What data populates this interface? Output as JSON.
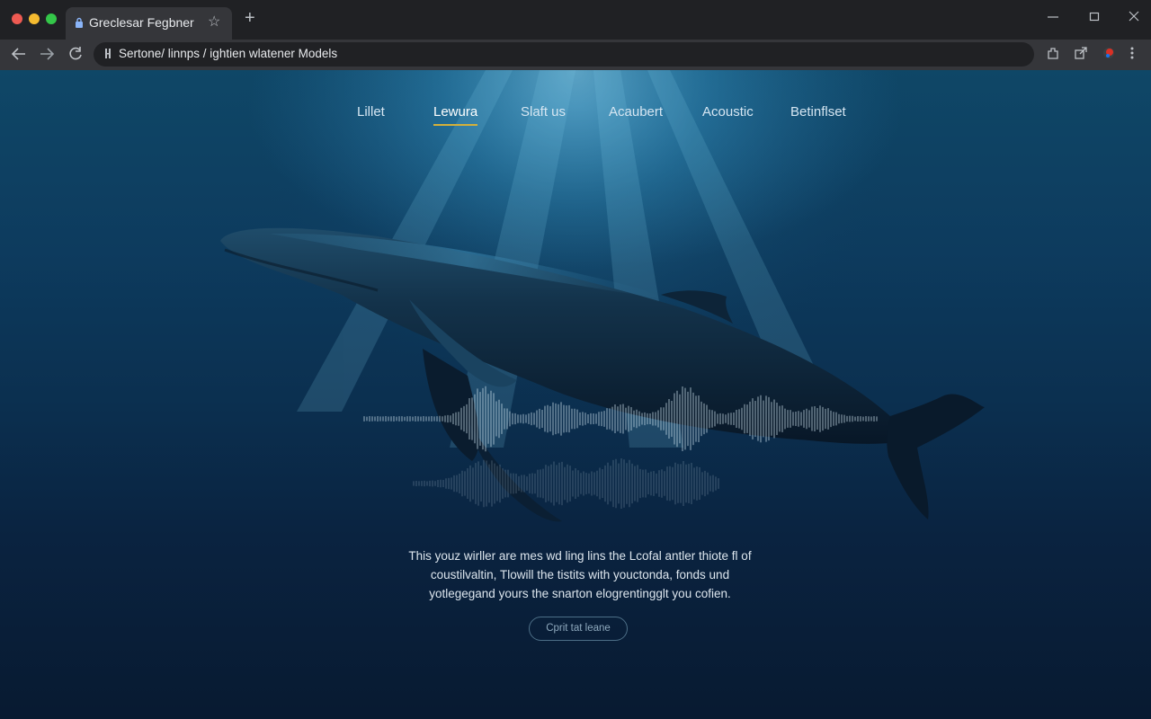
{
  "browser": {
    "tab_title": "Greclesar Fegbner",
    "url": "Sertone/ linnps / ightien wlatener Models"
  },
  "nav": {
    "items": [
      {
        "label": "Lillet"
      },
      {
        "label": "Lewura"
      },
      {
        "label": "Slaft us"
      },
      {
        "label": "Acaubert"
      },
      {
        "label": "Acoustic"
      },
      {
        "label": "Betinflset"
      }
    ],
    "active_index": 1
  },
  "hero": {
    "body_lines": [
      "This youz wirller are mes wd ling lins the Lcofal antler thiote fl of",
      "coustilvaltin, Tlowill the tistits with youctonda, fonds und",
      "yotlegegand yours the snarton elogrentingglt you cofien."
    ],
    "cta_label": "Cprit tat leane"
  },
  "colors": {
    "accent_underline": "#d4b03a",
    "chrome_bg": "#202124",
    "toolbar_bg": "#35363a",
    "ocean_top": "#0f4767",
    "ocean_bottom": "#081a31"
  },
  "icons": {
    "tab": "lock-icon",
    "star": "star-icon",
    "omnibox": "site-info-icon"
  }
}
